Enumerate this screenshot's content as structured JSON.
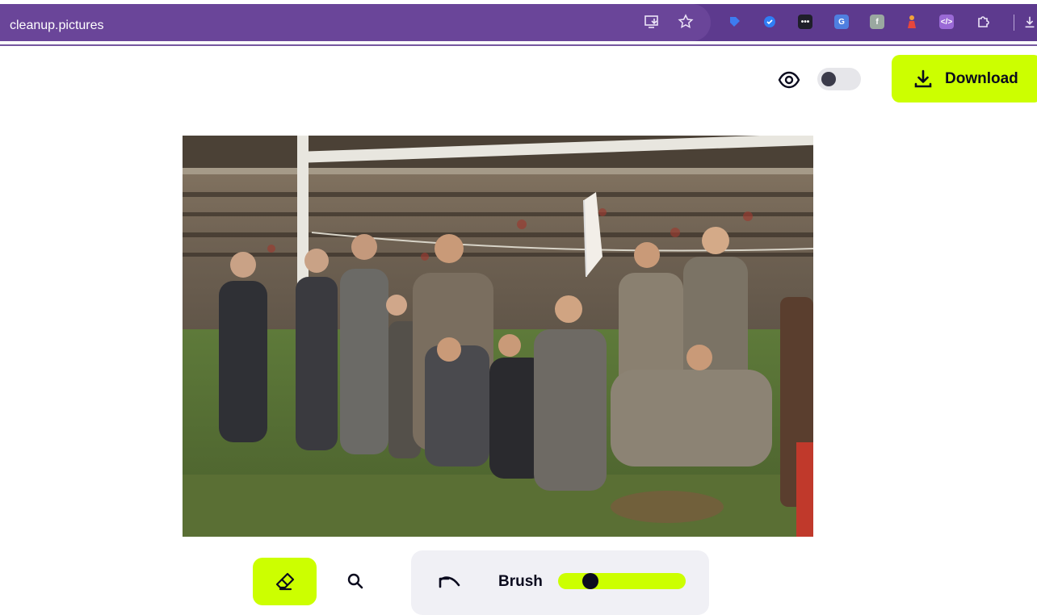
{
  "browser": {
    "url": "cleanup.pictures",
    "bar_color": "#5d3a8e",
    "icons": [
      "install-app-icon",
      "bookmark-star-icon",
      "tag-extension-icon",
      "check-extension-icon",
      "more-extension-icon",
      "translate-extension-icon",
      "font-extension-icon",
      "figure-extension-icon",
      "code-extension-icon",
      "extensions-puzzle-icon",
      "download-arrow-icon"
    ]
  },
  "toolbar": {
    "preview_icon": "eye-icon",
    "compare_toggle": {
      "on": false
    },
    "download_label": "Download",
    "download_icon": "download-icon",
    "accent_color": "#ccff00"
  },
  "editor": {
    "image_description_icon": "photo-canvas"
  },
  "tools": {
    "eraser_icon": "eraser-icon",
    "zoom_icon": "magnifier-icon",
    "undo_icon": "undo-icon",
    "brush_label": "Brush",
    "brush_size_fraction": 0.25
  }
}
